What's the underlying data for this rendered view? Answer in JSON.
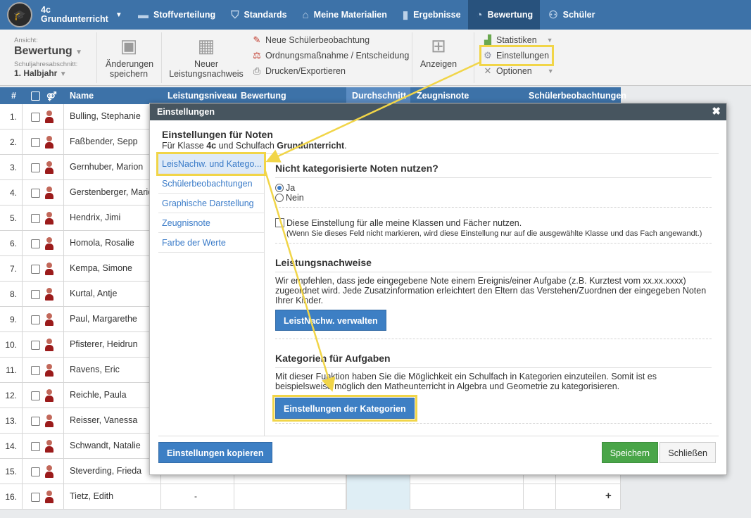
{
  "nav": {
    "class_name": "4c",
    "class_subject": "Grundunterricht",
    "items": [
      {
        "label": "Stoffverteilung"
      },
      {
        "label": "Standards"
      },
      {
        "label": "Meine Materialien"
      },
      {
        "label": "Ergebnisse"
      },
      {
        "label": "Bewertung"
      },
      {
        "label": "Schüler"
      }
    ]
  },
  "toolbar": {
    "view_label": "Ansicht:",
    "view_value": "Bewertung",
    "period_label": "Schuljahresabschnitt:",
    "period_value": "1. Halbjahr",
    "save_line1": "Änderungen",
    "save_line2": "speichern",
    "new_line1": "Neuer",
    "new_line2": "Leistungsnachweis",
    "actions": [
      "Neue Schülerbeobachtung",
      "Ordnungsmaßnahme / Entscheidung",
      "Drucken/Exportieren"
    ],
    "show_label": "Anzeigen",
    "options": [
      "Statistiken",
      "Einstellungen",
      "Optionen"
    ]
  },
  "table": {
    "headers": {
      "num": "#",
      "name": "Name",
      "level": "Leistungsniveau",
      "grade": "Bewertung",
      "avg": "Durchschnitt",
      "report": "Zeugnisnote",
      "obs": "Schülerbeobachtungen"
    },
    "rows": [
      {
        "num": "1.",
        "name": "Bulling, Stephanie"
      },
      {
        "num": "2.",
        "name": "Faßbender, Sepp"
      },
      {
        "num": "3.",
        "name": "Gernhuber, Marion"
      },
      {
        "num": "4.",
        "name": "Gerstenberger, Mario"
      },
      {
        "num": "5.",
        "name": "Hendrix, Jimi"
      },
      {
        "num": "6.",
        "name": "Homola, Rosalie"
      },
      {
        "num": "7.",
        "name": "Kempa, Simone"
      },
      {
        "num": "8.",
        "name": "Kurtal, Antje"
      },
      {
        "num": "9.",
        "name": "Paul, Margarethe"
      },
      {
        "num": "10.",
        "name": "Pfisterer, Heidrun"
      },
      {
        "num": "11.",
        "name": "Ravens, Eric"
      },
      {
        "num": "12.",
        "name": "Reichle, Paula"
      },
      {
        "num": "13.",
        "name": "Reisser, Vanessa"
      },
      {
        "num": "14.",
        "name": "Schwandt, Natalie"
      },
      {
        "num": "15.",
        "name": "Steverding, Frieda"
      },
      {
        "num": "16.",
        "name": "Tietz, Edith",
        "level": "-",
        "action": "+"
      }
    ]
  },
  "modal": {
    "title": "Einstellungen",
    "heading": "Einstellungen für Noten",
    "sub_prefix": "Für Klasse ",
    "sub_class": "4c",
    "sub_mid": " und Schulfach ",
    "sub_subject": "Grundunterricht",
    "sub_end": ".",
    "menu": [
      "LeisNachw. und Katego...",
      "Schülerbeobachtungen",
      "Graphische Darstellung",
      "Zeugnisnote",
      "Farbe der Werte"
    ],
    "section1": {
      "title": "Nicht kategorisierte Noten nutzen?",
      "opt_yes": "Ja",
      "opt_no": "Nein",
      "check_label": "Diese Einstellung für alle meine Klassen und Fächer nutzen.",
      "check_note": "(Wenn Sie dieses Feld nicht markieren, wird diese Einstellung nur auf die ausgewählte Klasse und das Fach angewandt.)"
    },
    "section2": {
      "title": "Leistungsnachweise",
      "text": "Wir empfehlen, dass jede eingegebene Note einem Ereignis/einer Aufgabe (z.B. Kurztest vom xx.xx.xxxx) zugeordnet wird. Jede Zusatzinformation erleichtert den Eltern das Verstehen/Zuordnen der eingegeben Noten Ihrer Kinder.",
      "button": "LeistNachw. verwalten"
    },
    "section3": {
      "title": "Kategorien für Aufgaben",
      "text": "Mit dieser Funktion haben Sie die Möglichkeit ein Schulfach in Kategorien einzuteilen. Somit ist es beispielsweise möglich den Matheunterricht in Algebra und Geometrie zu kategorisieren.",
      "button": "Einstellungen der Kategorien"
    },
    "copy_button": "Einstellungen kopieren",
    "save_button": "Speichern",
    "close_button": "Schließen"
  },
  "colors": {
    "nav": "#3d72a8",
    "highlight": "#f1d548",
    "accent": "#3d7fc4",
    "save": "#49a548"
  }
}
